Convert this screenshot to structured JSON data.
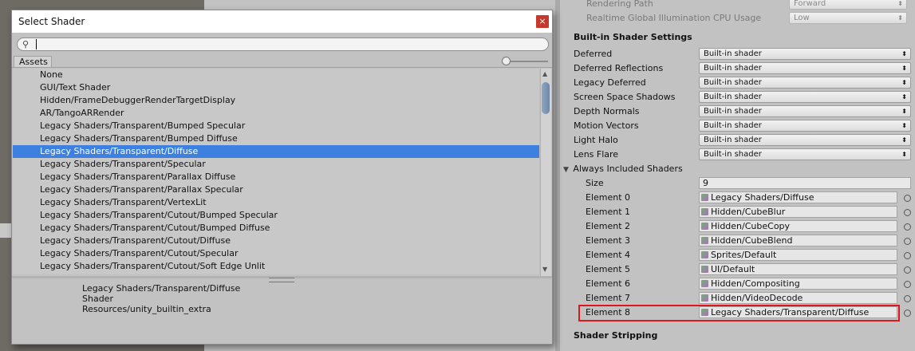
{
  "dialog": {
    "title": "Select Shader",
    "close_glyph": "×",
    "search": {
      "value": "",
      "placeholder": ""
    },
    "tab_label": "Assets",
    "items": [
      "None",
      "GUI/Text Shader",
      "Hidden/FrameDebuggerRenderTargetDisplay",
      "AR/TangoARRender",
      "Legacy Shaders/Transparent/Bumped Specular",
      "Legacy Shaders/Transparent/Bumped Diffuse",
      "Legacy Shaders/Transparent/Diffuse",
      "Legacy Shaders/Transparent/Specular",
      "Legacy Shaders/Transparent/Parallax Diffuse",
      "Legacy Shaders/Transparent/Parallax Specular",
      "Legacy Shaders/Transparent/VertexLit",
      "Legacy Shaders/Transparent/Cutout/Bumped Specular",
      "Legacy Shaders/Transparent/Cutout/Bumped Diffuse",
      "Legacy Shaders/Transparent/Cutout/Diffuse",
      "Legacy Shaders/Transparent/Cutout/Specular",
      "Legacy Shaders/Transparent/Cutout/Soft Edge Unlit"
    ],
    "selected_index": 6,
    "selection_color": "#3d80df",
    "info": {
      "name": "Legacy Shaders/Transparent/Diffuse",
      "type": "Shader",
      "path": "Resources/unity_builtin_extra"
    }
  },
  "inspector": {
    "top_rows": [
      {
        "label": "Rendering Path",
        "value": "Forward"
      },
      {
        "label": "Realtime Global Illumination CPU Usage",
        "value": "Low"
      }
    ],
    "builtin_title": "Built-in Shader Settings",
    "builtin_rows": [
      {
        "label": "Deferred",
        "value": "Built-in shader"
      },
      {
        "label": "Deferred Reflections",
        "value": "Built-in shader"
      },
      {
        "label": "Legacy Deferred",
        "value": "Built-in shader"
      },
      {
        "label": "Screen Space Shadows",
        "value": "Built-in shader"
      },
      {
        "label": "Depth Normals",
        "value": "Built-in shader"
      },
      {
        "label": "Motion Vectors",
        "value": "Built-in shader"
      },
      {
        "label": "Light Halo",
        "value": "Built-in shader"
      },
      {
        "label": "Lens Flare",
        "value": "Built-in shader"
      }
    ],
    "always_title": "Always Included Shaders",
    "size_label": "Size",
    "size_value": "9",
    "elements": [
      {
        "label": "Element 0",
        "value": "Legacy Shaders/Diffuse"
      },
      {
        "label": "Element 1",
        "value": "Hidden/CubeBlur"
      },
      {
        "label": "Element 2",
        "value": "Hidden/CubeCopy"
      },
      {
        "label": "Element 3",
        "value": "Hidden/CubeBlend"
      },
      {
        "label": "Element 4",
        "value": "Sprites/Default"
      },
      {
        "label": "Element 5",
        "value": "UI/Default"
      },
      {
        "label": "Element 6",
        "value": "Hidden/Compositing"
      },
      {
        "label": "Element 7",
        "value": "Hidden/VideoDecode"
      },
      {
        "label": "Element 8",
        "value": "Legacy Shaders/Transparent/Diffuse"
      }
    ],
    "highlight_color": "#e0151e",
    "stripping_title": "Shader Stripping"
  }
}
